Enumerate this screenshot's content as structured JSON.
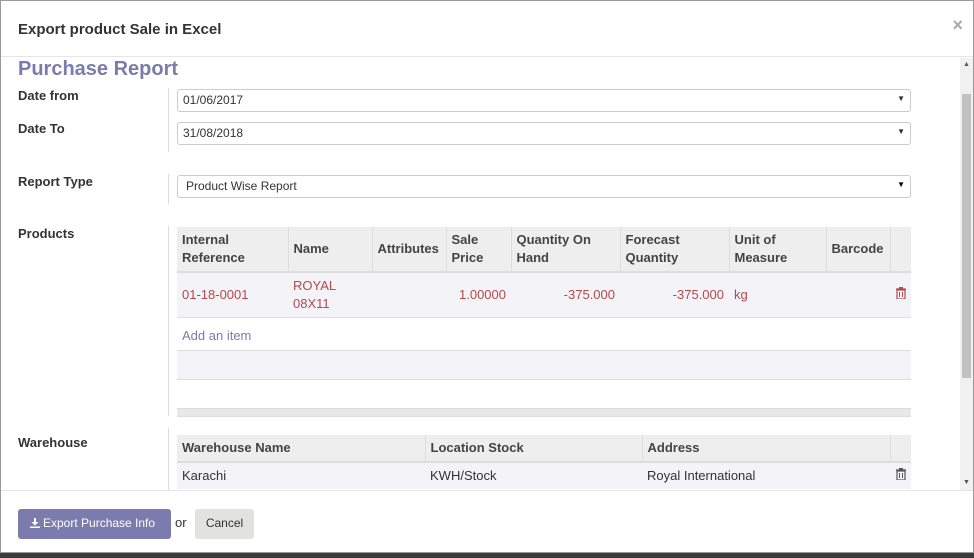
{
  "dialog": {
    "title": "Export product Sale in Excel",
    "close_glyph": "×"
  },
  "form": {
    "title": "Purchase Report",
    "date_from_label": "Date from",
    "date_from_value": "01/06/2017",
    "date_to_label": "Date To",
    "date_to_value": "31/08/2018",
    "report_type_label": "Report Type",
    "report_type_value": "Product Wise Report",
    "products_label": "Products",
    "warehouse_label": "Warehouse"
  },
  "products_table": {
    "headers": [
      "Internal Reference",
      "Name",
      "Attributes",
      "Sale Price",
      "Quantity On Hand",
      "Forecast Quantity",
      "Unit of Measure",
      "Barcode"
    ],
    "rows": [
      {
        "ref": "01-18-0001",
        "name": "ROYAL 08X11",
        "attributes": "",
        "sale_price": "1.00000",
        "qty_on_hand": "-375.000",
        "forecast": "-375.000",
        "uom": "kg",
        "barcode": ""
      }
    ],
    "add_item_label": "Add an item"
  },
  "warehouse_table": {
    "headers": [
      "Warehouse Name",
      "Location Stock",
      "Address"
    ],
    "rows": [
      {
        "name": "Karachi",
        "location": "KWH/Stock",
        "address": "Royal International"
      }
    ]
  },
  "footer": {
    "export_label": "Export Purchase Info",
    "or_label": "or",
    "cancel_label": "Cancel"
  },
  "icons": {
    "trash": "trash-icon",
    "download": "download-icon",
    "dropdown": "caret-down-icon"
  },
  "colors": {
    "accent": "#7c7bad",
    "row_text": "#b34a4a"
  }
}
